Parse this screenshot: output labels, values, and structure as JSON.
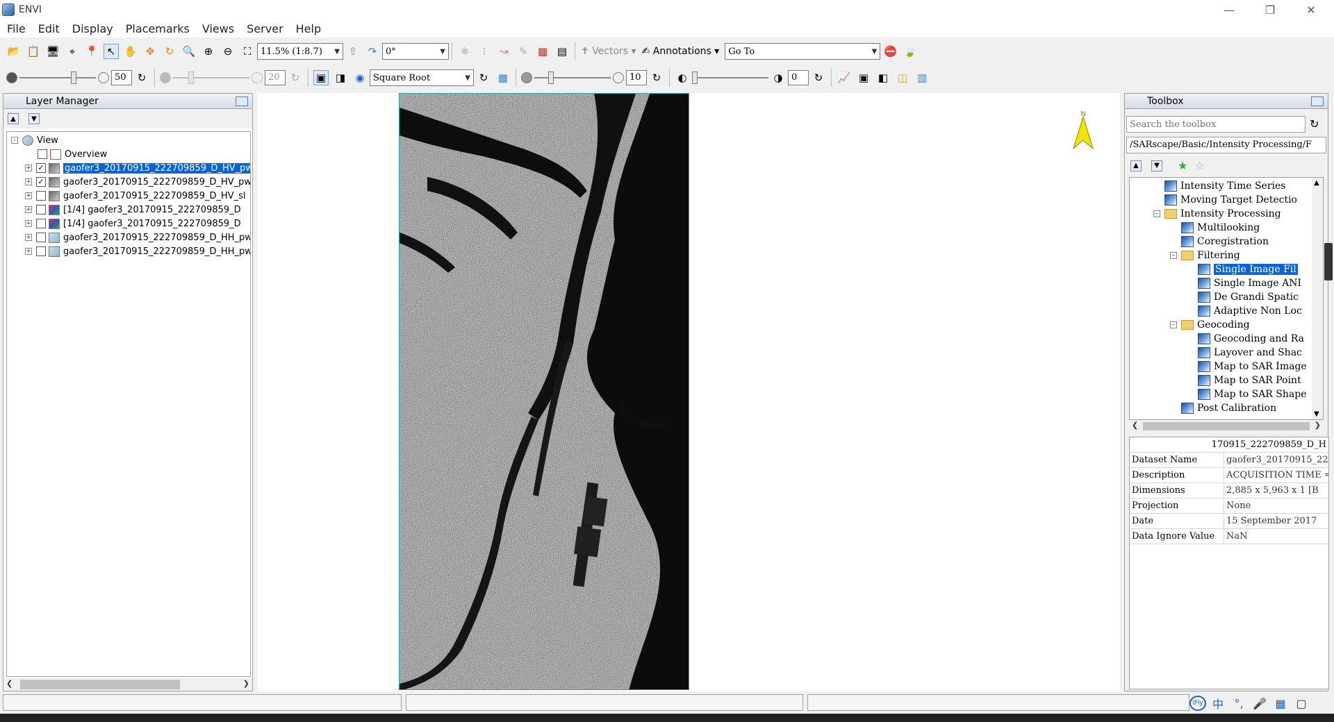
{
  "window": {
    "title": "ENVI"
  },
  "menu": [
    "File",
    "Edit",
    "Display",
    "Placemarks",
    "Views",
    "Server",
    "Help"
  ],
  "toolbar1": {
    "zoom": "11.5% (1:8.7)",
    "rotation": "0°",
    "vectors_label": "Vectors",
    "annotations_label": "Annotations",
    "goto_label": "Go To"
  },
  "toolbar2": {
    "brightness": "50",
    "contrast": "20",
    "stretch": "Square Root",
    "sharpen": "10",
    "transparency": "0"
  },
  "layer_manager": {
    "title": "Layer Manager",
    "root": "View",
    "overview": "Overview",
    "layers": [
      {
        "name": "gaofer3_20170915_222709859_D_HV_pw:",
        "checked": true,
        "selected": true,
        "icon": "gray"
      },
      {
        "name": "gaofer3_20170915_222709859_D_HV_pw:",
        "checked": true,
        "selected": false,
        "icon": "gray"
      },
      {
        "name": "gaofer3_20170915_222709859_D_HV_sl",
        "checked": false,
        "selected": false,
        "icon": "gray"
      },
      {
        "name": "[1/4] gaofer3_20170915_222709859_D",
        "checked": false,
        "selected": false,
        "icon": "color"
      },
      {
        "name": "[1/4] gaofer3_20170915_222709859_D",
        "checked": false,
        "selected": false,
        "icon": "color"
      },
      {
        "name": "gaofer3_20170915_222709859_D_HH_pw:",
        "checked": false,
        "selected": false,
        "icon": "pale"
      },
      {
        "name": "gaofer3_20170915_222709859_D_HH_pw:",
        "checked": false,
        "selected": false,
        "icon": "pale"
      }
    ]
  },
  "toolbox": {
    "title": "Toolbox",
    "search_placeholder": "Search the toolbox",
    "path": "/SARscape/Basic/Intensity Processing/F",
    "tree": [
      {
        "label": "Intensity Time Series",
        "kind": "tool",
        "indent": 0
      },
      {
        "label": "Moving Target Detectio",
        "kind": "tool",
        "indent": 0
      },
      {
        "label": "Intensity Processing",
        "kind": "folder",
        "indent": 0,
        "expanded": true
      },
      {
        "label": "Multilooking",
        "kind": "tool",
        "indent": 1
      },
      {
        "label": "Coregistration",
        "kind": "tool",
        "indent": 1
      },
      {
        "label": "Filtering",
        "kind": "folder",
        "indent": 1,
        "expanded": true
      },
      {
        "label": "Single Image Fil",
        "kind": "tool",
        "indent": 2,
        "selected": true
      },
      {
        "label": "Single Image ANI",
        "kind": "tool",
        "indent": 2
      },
      {
        "label": "De Grandi Spatic",
        "kind": "tool",
        "indent": 2
      },
      {
        "label": "Adaptive Non Loc",
        "kind": "tool",
        "indent": 2
      },
      {
        "label": "Geocoding",
        "kind": "folder",
        "indent": 1,
        "expanded": true
      },
      {
        "label": "Geocoding and Ra",
        "kind": "tool",
        "indent": 2
      },
      {
        "label": "Layover and Shac",
        "kind": "tool",
        "indent": 2
      },
      {
        "label": "Map to SAR Image",
        "kind": "tool",
        "indent": 2
      },
      {
        "label": "Map to SAR Point",
        "kind": "tool",
        "indent": 2
      },
      {
        "label": "Map to SAR Shape",
        "kind": "tool",
        "indent": 2
      },
      {
        "label": "Post Calibration",
        "kind": "tool",
        "indent": 1
      }
    ]
  },
  "properties": {
    "header": "170915_222709859_D_H",
    "rows": [
      {
        "key": "Dataset Name",
        "value": "gaofer3_20170915_222"
      },
      {
        "key": "Description",
        "value": "ACQUISITION TIME = 2"
      },
      {
        "key": "Dimensions",
        "value": "2,885 x 5,963 x 1 [B"
      },
      {
        "key": "Projection",
        "value": "None"
      },
      {
        "key": "Date",
        "value": "15 September 2017"
      },
      {
        "key": "Data Ignore Value",
        "value": "NaN"
      }
    ]
  },
  "north_label": "N",
  "colors": {
    "selection": "#0a64d8",
    "image_border": "#22aaaa",
    "north": "#f2e600"
  }
}
